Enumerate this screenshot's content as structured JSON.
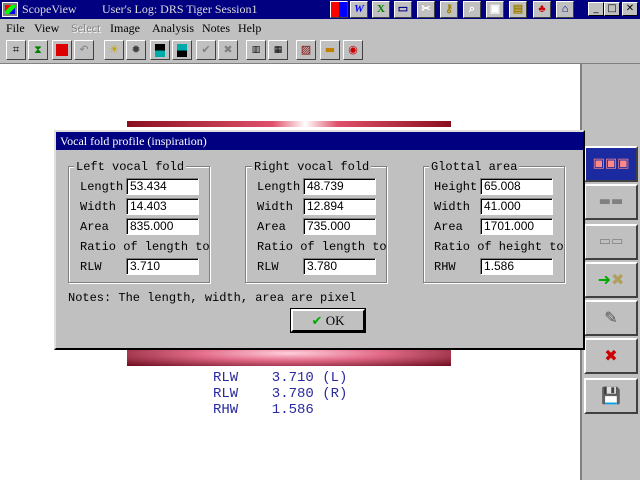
{
  "app": {
    "title": "ScopeView",
    "log": "User's Log:  DRS Tiger Session1"
  },
  "titlebar_icons": [
    "grid-icon",
    "w-icon",
    "x-icon",
    "window-icon",
    "tools-icon",
    "key-icon",
    "search-icon",
    "crop-icon",
    "note-icon",
    "shapes-icon",
    "home-icon"
  ],
  "menu": {
    "file": "File",
    "view": "View",
    "select": "Select",
    "image": "Image",
    "analysis": "Analysis",
    "notes": "Notes",
    "help": "Help"
  },
  "dialog": {
    "title": "Vocal fold profile (inspiration)",
    "left": {
      "label": "Left vocal fold",
      "length_label": "Length",
      "length": "53.434",
      "width_label": "Width",
      "width": "14.403",
      "area_label": "Area",
      "area": "835.000",
      "ratio_label": "Ratio of length to",
      "rlw_label": "RLW",
      "rlw": "3.710"
    },
    "right": {
      "label": "Right vocal fold",
      "length_label": "Length",
      "length": "48.739",
      "width_label": "Width",
      "width": "12.894",
      "area_label": "Area",
      "area": "735.000",
      "ratio_label": "Ratio of length to",
      "rlw_label": "RLW",
      "rlw": "3.780"
    },
    "glottal": {
      "label": "Glottal area",
      "height_label": "Height",
      "height": "65.008",
      "width_label": "Width",
      "width": "41.000",
      "area_label": "Area",
      "area": "1701.000",
      "ratio_label": "Ratio of height to",
      "rhw_label": "RHW",
      "rhw": "1.586"
    },
    "notes": "Notes: The length, width, area are pixel",
    "ok": "OK"
  },
  "summary": [
    "RLW    3.710 (L)",
    "RLW    3.780 (R)",
    "RHW    1.586"
  ],
  "colors": {
    "titlebar": "#000080",
    "summary_text": "#2a2aa0",
    "face": "#c0c0c0"
  }
}
